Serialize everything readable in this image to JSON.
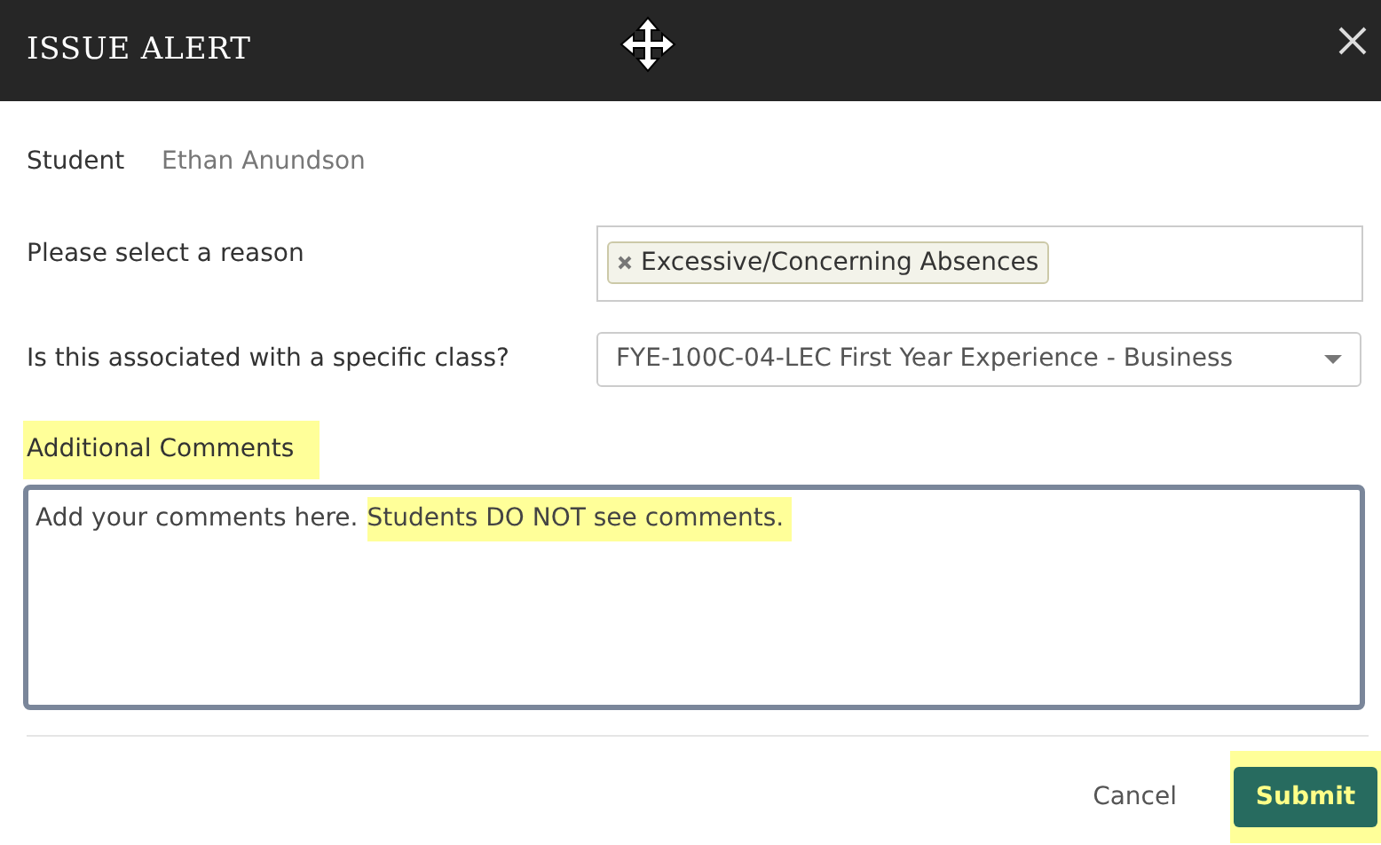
{
  "dialog": {
    "title": "ISSUE ALERT"
  },
  "fields": [
    {
      "kind": "static",
      "label": "Student",
      "value": "Ethan Anundson"
    },
    {
      "kind": "tags",
      "label": "Please select a reason",
      "tags": [
        "Excessive/Concerning Absences"
      ]
    },
    {
      "kind": "select",
      "label": "Is this associated with a specific class?",
      "value": "FYE-100C-04-LEC First Year Experience - Business"
    },
    {
      "kind": "textarea",
      "label": "Additional Comments",
      "label_highlighted": true,
      "segments": [
        {
          "text": "Add your comments here.",
          "highlighted": false
        },
        {
          "text": "Students DO NOT see comments.",
          "highlighted": true
        }
      ]
    }
  ],
  "buttons": [
    {
      "kind": "link",
      "label": "Cancel",
      "highlighted": false
    },
    {
      "kind": "primary",
      "label": "Submit",
      "highlighted": true
    }
  ]
}
